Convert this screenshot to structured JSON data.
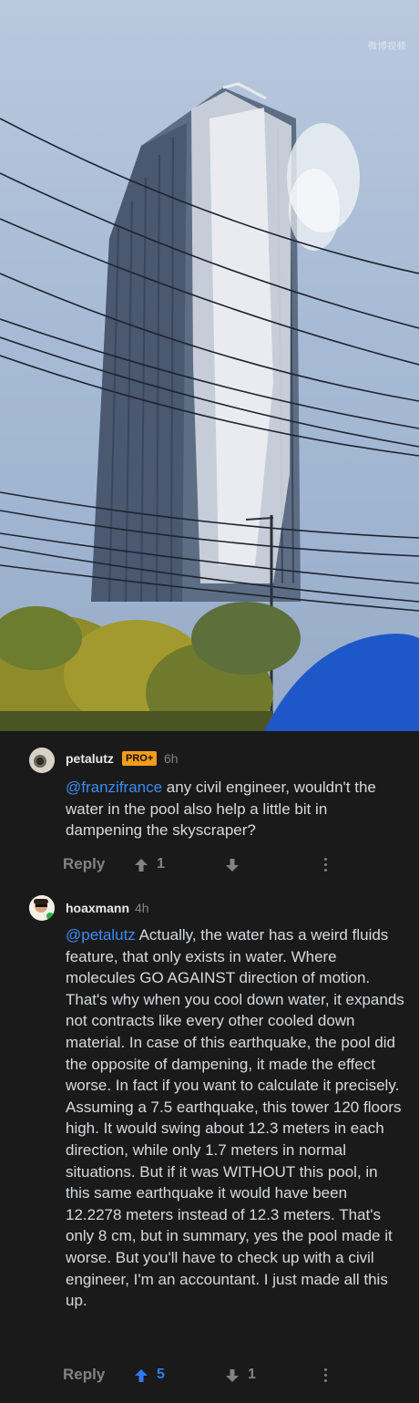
{
  "media": {
    "watermark": "微博视频"
  },
  "comments": [
    {
      "username": "petalutz",
      "badge": "PRO+",
      "time": "6h",
      "mention": "@franzifrance",
      "text": " any civil engineer, wouldn't the water in the pool also help a little bit in dampening the skyscraper?",
      "reply_label": "Reply",
      "upvotes": "1",
      "downvotes": ""
    },
    {
      "username": "hoaxmann",
      "time": "4h",
      "mention": "@petalutz",
      "text": " Actually, the water has a weird fluids feature, that only exists in water. Where molecules GO AGAINST direction of motion. That's why when you cool down water, it expands not contracts like every other cooled down material. In case of this earthquake, the pool did the opposite of dampening, it made the effect worse. In fact if you want to calculate it precisely. Assuming a 7.5 earthquake, this tower 120 floors high. It would swing about 12.3 meters in each direction, while only 1.7 meters in normal situations. But if it was WITHOUT this pool, in this same earthquake it would have been 12.2278 meters instead of 12.3 meters. That's only 8 cm, but in summary, yes the pool made it worse. But you'll have to check up with a civil engineer, I'm an accountant. I just made all this up.",
      "reply_label": "Reply",
      "upvotes": "5",
      "downvotes": "1"
    }
  ],
  "colors": {
    "background": "#1a1a1b",
    "mention": "#3d8cf0",
    "upvoted": "#2f7bf0",
    "badge": "#f39c1b",
    "muted": "#818384"
  }
}
